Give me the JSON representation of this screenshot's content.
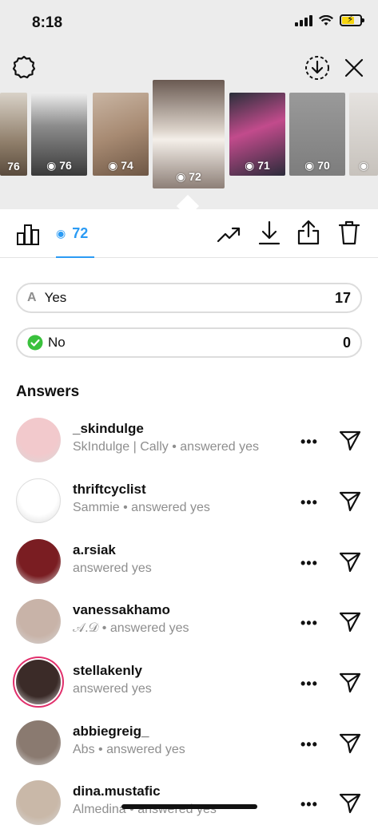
{
  "status_bar": {
    "time": "8:18"
  },
  "thumbnails": [
    {
      "views": "76"
    },
    {
      "views": "76"
    },
    {
      "views": "74"
    },
    {
      "views": "72",
      "selected": true
    },
    {
      "views": "71"
    },
    {
      "views": "70"
    },
    {
      "views": ""
    }
  ],
  "tabs": {
    "views_count": "72"
  },
  "poll": {
    "options": [
      {
        "label": "Yes",
        "count": "17",
        "badge": "A"
      },
      {
        "label": "No",
        "count": "0",
        "badge": "check"
      }
    ]
  },
  "answers": {
    "title": "Answers",
    "items": [
      {
        "username": "_skindulge",
        "subtitle": "SkIndulge | Cally • answered yes",
        "avatar_color": "#f2c9cc"
      },
      {
        "username": "thriftcyclist",
        "subtitle": "Sammie • answered yes",
        "avatar_color": "#ffffff"
      },
      {
        "username": "a.rsiak",
        "subtitle": "answered yes",
        "avatar_color": "#7a1d22"
      },
      {
        "username": "vanessakhamo",
        "subtitle": "𝒜.𝒟 • answered yes",
        "avatar_color": "#c8b3a8"
      },
      {
        "username": "stellakenly",
        "subtitle": "answered yes",
        "avatar_color": "#3b2b28"
      },
      {
        "username": "abbiegreig_",
        "subtitle": "Abs • answered yes",
        "avatar_color": "#8a7a70"
      },
      {
        "username": "dina.mustafic",
        "subtitle": "Almedina • answered yes",
        "avatar_color": "#c9b8a8"
      }
    ]
  },
  "colors": {
    "accent": "#2b9bf4",
    "check_green": "#3ac13d"
  }
}
